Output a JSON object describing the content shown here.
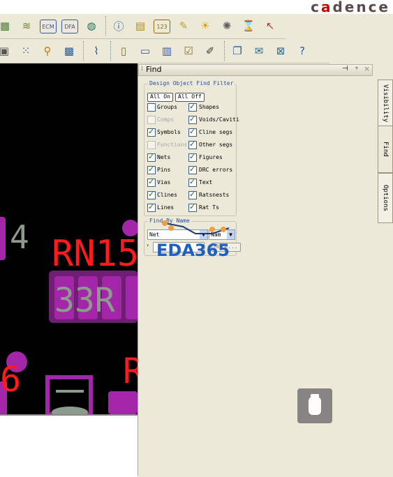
{
  "brand": {
    "text_a": "c",
    "text_accent": "a",
    "text_b": "dence"
  },
  "toolbar1": {
    "items": [
      {
        "name": "layers-icon",
        "glyph": "▦",
        "color": "#4a7a3a"
      },
      {
        "name": "stack-icon",
        "glyph": "≋",
        "color": "#6b8a2a"
      },
      {
        "name": "ecm-icon",
        "glyph": "ECM",
        "color": "#3a5a9a"
      },
      {
        "name": "dfa-icon",
        "glyph": "DFA",
        "color": "#3a5a9a"
      },
      {
        "name": "globe-grid-icon",
        "glyph": "◍",
        "color": "#2a6a5a"
      },
      {
        "name": "info-icon",
        "glyph": "ⓘ",
        "color": "#2a5ab0"
      },
      {
        "name": "report-icon",
        "glyph": "▤",
        "color": "#b08a20"
      },
      {
        "name": "numbers-icon",
        "glyph": "123",
        "color": "#8a6a10"
      },
      {
        "name": "brush-icon",
        "glyph": "✎",
        "color": "#c0a030"
      },
      {
        "name": "sun-icon",
        "glyph": "☀",
        "color": "#e0a000"
      },
      {
        "name": "bulb-icon",
        "glyph": "✺",
        "color": "#606060"
      },
      {
        "name": "hourglass-icon",
        "glyph": "⌛",
        "color": "#1a8a3a"
      },
      {
        "name": "cursor-select-icon",
        "glyph": "↖",
        "color": "#c03030"
      }
    ]
  },
  "toolbar2": {
    "items": [
      {
        "name": "grid-partial-icon",
        "glyph": "▣",
        "color": "#555"
      },
      {
        "name": "dot-grid-icon",
        "glyph": "⁙",
        "color": "#2a5a9a"
      },
      {
        "name": "pin-tool-icon",
        "glyph": "⚲",
        "color": "#c07a10"
      },
      {
        "name": "matrix-icon",
        "glyph": "▩",
        "color": "#2a5a9a"
      },
      {
        "name": "route-icon",
        "glyph": "⌇",
        "color": "#2a4a9a"
      },
      {
        "name": "doc-edit-icon",
        "glyph": "▯",
        "color": "#8a6a20"
      },
      {
        "name": "book-icon",
        "glyph": "▭",
        "color": "#3a5a9a"
      },
      {
        "name": "chip-icon",
        "glyph": "▥",
        "color": "#3a5a9a"
      },
      {
        "name": "checklist-icon",
        "glyph": "☑",
        "color": "#8a6a20"
      },
      {
        "name": "pen-icon",
        "glyph": "✐",
        "color": "#3a3a3a"
      },
      {
        "name": "copy-icon",
        "glyph": "❐",
        "color": "#2a5a9a"
      },
      {
        "name": "mail-icon",
        "glyph": "✉",
        "color": "#2a6a9a"
      },
      {
        "name": "envelope-icon",
        "glyph": "⊠",
        "color": "#2a6a9a"
      },
      {
        "name": "help-icon",
        "glyph": "?",
        "color": "#2a5ab0"
      }
    ]
  },
  "canvas": {
    "labels": {
      "four": "4",
      "rn": "RN15",
      "res": "33R",
      "six": "6",
      "r": "R"
    }
  },
  "find": {
    "title": "Find",
    "filter_legend": "Design Object Find Filter",
    "all_on": "All On",
    "all_off": "All Off",
    "left_items": [
      {
        "label": "Groups",
        "checked": false,
        "disabled": false
      },
      {
        "label": "Comps",
        "checked": false,
        "disabled": true
      },
      {
        "label": "Symbols",
        "checked": true,
        "disabled": false
      },
      {
        "label": "Functions",
        "checked": false,
        "disabled": true
      },
      {
        "label": "Nets",
        "checked": true,
        "disabled": false
      },
      {
        "label": "Pins",
        "checked": true,
        "disabled": false
      },
      {
        "label": "Vias",
        "checked": true,
        "disabled": false
      },
      {
        "label": "Clines",
        "checked": true,
        "disabled": false
      },
      {
        "label": "Lines",
        "checked": true,
        "disabled": false
      }
    ],
    "right_items": [
      {
        "label": "Shapes",
        "checked": true
      },
      {
        "label": "Voids/Caviti",
        "checked": true
      },
      {
        "label": "Cline segs",
        "checked": true
      },
      {
        "label": "Other segs",
        "checked": true
      },
      {
        "label": "Figures",
        "checked": true
      },
      {
        "label": "DRC errors",
        "checked": true
      },
      {
        "label": "Text",
        "checked": true
      },
      {
        "label": "Ratsnests",
        "checked": true
      },
      {
        "label": "Rat Ts",
        "checked": true
      }
    ],
    "name_legend": "Find By Name",
    "type_select": "Net",
    "mode_select": "Nam",
    "more_button": "More...",
    "watermark": "EDA365"
  },
  "tabs": {
    "visibility": "Visibility",
    "find": "Find",
    "options": "Options"
  },
  "colors": {
    "pcb_bg": "#000000",
    "pad": "#a326a8",
    "silk_red": "#ff1b1b",
    "silk_gray": "#8c9b8c"
  }
}
